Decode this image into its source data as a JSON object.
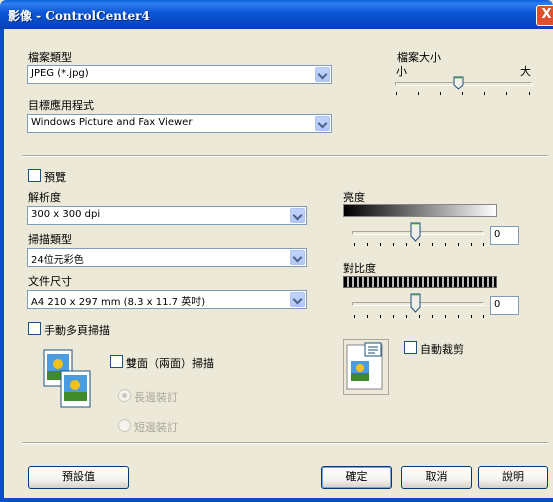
{
  "window": {
    "title": "影像 - ControlCenter4",
    "close_glyph": "X"
  },
  "file_type": {
    "label": "檔案類型",
    "value": "JPEG (*.jpg)"
  },
  "target_app": {
    "label": "目標應用程式",
    "value": "Windows Picture and Fax Viewer"
  },
  "file_size": {
    "label": "檔案大小",
    "min_label": "小",
    "max_label": "大",
    "level": 0.46
  },
  "preview": {
    "label": "預覽",
    "checked": false
  },
  "resolution": {
    "label": "解析度",
    "value": "300 x 300 dpi"
  },
  "scan_type": {
    "label": "掃描類型",
    "value": "24位元彩色"
  },
  "doc_size": {
    "label": "文件尺寸",
    "value": "A4 210 x 297 mm (8.3 x 11.7 英吋)"
  },
  "brightness": {
    "label": "亮度",
    "value": "0"
  },
  "contrast": {
    "label": "對比度",
    "value": "0"
  },
  "manual_multipage": {
    "label": "手動多頁掃描",
    "checked": false
  },
  "duplex": {
    "label": "雙面（兩面）掃描",
    "checked": false,
    "long_edge": "長邊裝訂",
    "short_edge": "短邊裝訂"
  },
  "auto_crop": {
    "label": "自動裁剪",
    "checked": false
  },
  "buttons": {
    "defaults": "預設值",
    "ok": "確定",
    "cancel": "取消",
    "help": "說明"
  },
  "icons": {
    "duplex": "duplex-pages-icon",
    "autocrop": "auto-crop-icon"
  }
}
